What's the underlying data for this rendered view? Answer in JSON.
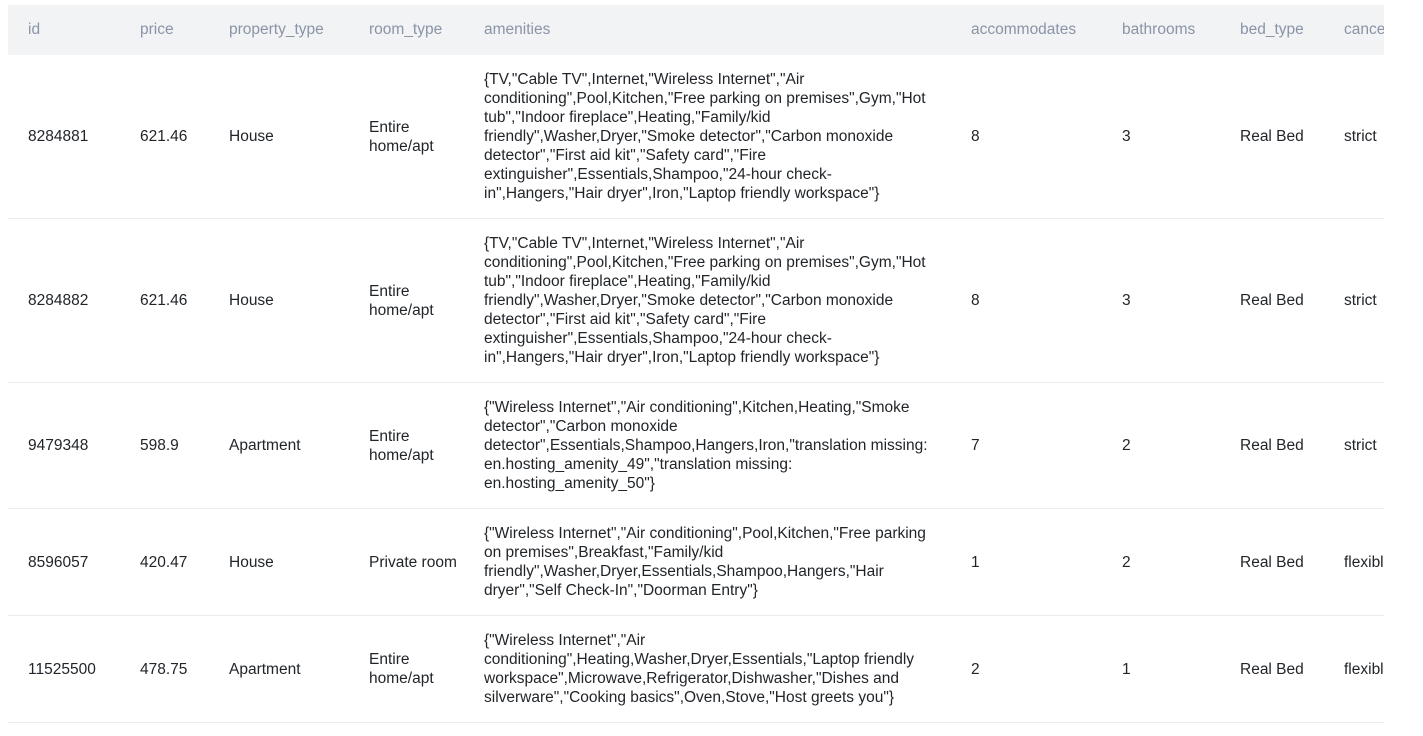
{
  "table": {
    "columns": [
      "id",
      "price",
      "property_type",
      "room_type",
      "amenities",
      "accommodates",
      "bathrooms",
      "bed_type",
      "cancellation_policy"
    ],
    "rows": [
      {
        "id": "8284881",
        "price": "621.46",
        "property_type": "House",
        "room_type": "Entire home/apt",
        "amenities": "{TV,\"Cable TV\",Internet,\"Wireless Internet\",\"Air conditioning\",Pool,Kitchen,\"Free parking on premises\",Gym,\"Hot tub\",\"Indoor fireplace\",Heating,\"Family/kid friendly\",Washer,Dryer,\"Smoke detector\",\"Carbon monoxide detector\",\"First aid kit\",\"Safety card\",\"Fire extinguisher\",Essentials,Shampoo,\"24-hour check-in\",Hangers,\"Hair dryer\",Iron,\"Laptop friendly workspace\"}",
        "accommodates": "8",
        "bathrooms": "3",
        "bed_type": "Real Bed",
        "cancellation_policy": "strict"
      },
      {
        "id": "8284882",
        "price": "621.46",
        "property_type": "House",
        "room_type": "Entire home/apt",
        "amenities": "{TV,\"Cable TV\",Internet,\"Wireless Internet\",\"Air conditioning\",Pool,Kitchen,\"Free parking on premises\",Gym,\"Hot tub\",\"Indoor fireplace\",Heating,\"Family/kid friendly\",Washer,Dryer,\"Smoke detector\",\"Carbon monoxide detector\",\"First aid kit\",\"Safety card\",\"Fire extinguisher\",Essentials,Shampoo,\"24-hour check-in\",Hangers,\"Hair dryer\",Iron,\"Laptop friendly workspace\"}",
        "accommodates": "8",
        "bathrooms": "3",
        "bed_type": "Real Bed",
        "cancellation_policy": "strict"
      },
      {
        "id": "9479348",
        "price": "598.9",
        "property_type": "Apartment",
        "room_type": "Entire home/apt",
        "amenities": "{\"Wireless Internet\",\"Air conditioning\",Kitchen,Heating,\"Smoke detector\",\"Carbon monoxide detector\",Essentials,Shampoo,Hangers,Iron,\"translation missing: en.hosting_amenity_49\",\"translation missing: en.hosting_amenity_50\"}",
        "accommodates": "7",
        "bathrooms": "2",
        "bed_type": "Real Bed",
        "cancellation_policy": "strict"
      },
      {
        "id": "8596057",
        "price": "420.47",
        "property_type": "House",
        "room_type": "Private room",
        "amenities": "{\"Wireless Internet\",\"Air conditioning\",Pool,Kitchen,\"Free parking on premises\",Breakfast,\"Family/kid friendly\",Washer,Dryer,Essentials,Shampoo,Hangers,\"Hair dryer\",\"Self Check-In\",\"Doorman Entry\"}",
        "accommodates": "1",
        "bathrooms": "2",
        "bed_type": "Real Bed",
        "cancellation_policy": "flexible"
      },
      {
        "id": "11525500",
        "price": "478.75",
        "property_type": "Apartment",
        "room_type": "Entire home/apt",
        "amenities": "{\"Wireless Internet\",\"Air conditioning\",Heating,Washer,Dryer,Essentials,\"Laptop friendly workspace\",Microwave,Refrigerator,Dishwasher,\"Dishes and silverware\",\"Cooking basics\",Oven,Stove,\"Host greets you\"}",
        "accommodates": "2",
        "bathrooms": "1",
        "bed_type": "Real Bed",
        "cancellation_policy": "flexible"
      }
    ]
  }
}
